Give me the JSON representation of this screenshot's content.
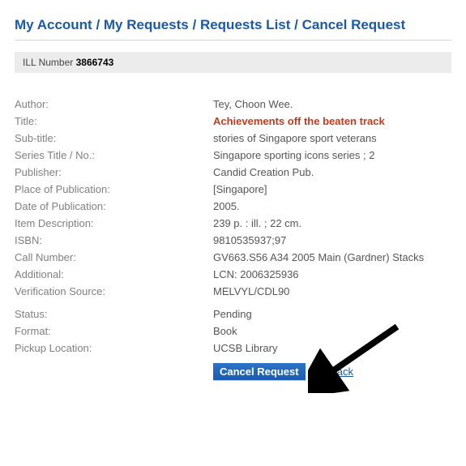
{
  "breadcrumb": {
    "a": "My Account",
    "b": "My Requests",
    "c": "Requests List",
    "d": "Cancel Request",
    "sep": " / "
  },
  "ill": {
    "label": "ILL Number",
    "value": "3866743"
  },
  "fields": {
    "author": {
      "label": "Author:",
      "value": "Tey, Choon Wee."
    },
    "title": {
      "label": "Title:",
      "value": "Achievements off the beaten track"
    },
    "subtitle": {
      "label": "Sub-title:",
      "value": "stories of Singapore sport veterans"
    },
    "series": {
      "label": "Series Title / No.:",
      "value": "Singapore sporting icons series ; 2"
    },
    "publisher": {
      "label": "Publisher:",
      "value": "Candid Creation Pub."
    },
    "place": {
      "label": "Place of Publication:",
      "value": "[Singapore]"
    },
    "date": {
      "label": "Date of Publication:",
      "value": "2005."
    },
    "itemdesc": {
      "label": "Item Description:",
      "value": "239 p. : ill. ; 22 cm."
    },
    "isbn": {
      "label": "ISBN:",
      "value": "9810535937;97"
    },
    "callnum": {
      "label": "Call Number:",
      "value": "GV663.S56 A34 2005 Main (Gardner) Stacks"
    },
    "additional": {
      "label": "Additional:",
      "value": "LCN: 2006325936"
    },
    "verif": {
      "label": "Verification Source:",
      "value": "MELVYL/CDL90"
    },
    "status": {
      "label": "Status:",
      "value": "Pending"
    },
    "format": {
      "label": "Format:",
      "value": "Book"
    },
    "pickup": {
      "label": "Pickup Location:",
      "value": "UCSB Library"
    }
  },
  "actions": {
    "cancel": "Cancel Request",
    "goback": "Go Back"
  }
}
